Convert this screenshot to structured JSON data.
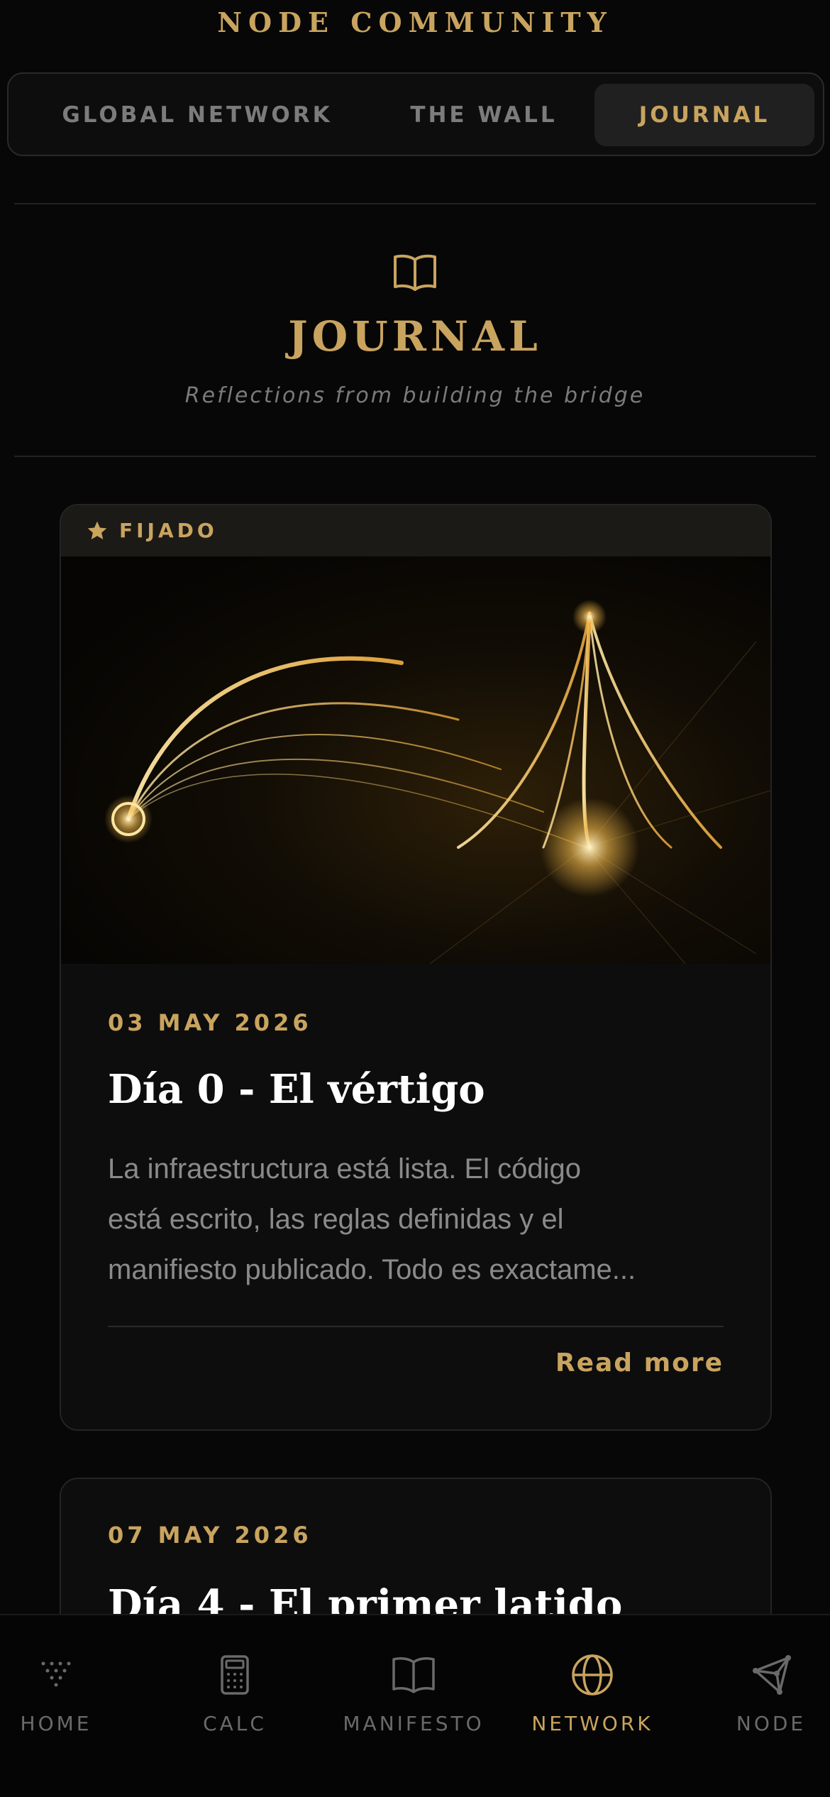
{
  "app": {
    "title": "NODE COMMUNITY"
  },
  "tabs": [
    {
      "label": "GLOBAL NETWORK",
      "active": false
    },
    {
      "label": "THE WALL",
      "active": false
    },
    {
      "label": "JOURNAL",
      "active": true
    }
  ],
  "section": {
    "icon": "book-open-icon",
    "title": "JOURNAL",
    "subtitle": "Reflections from building the bridge"
  },
  "posts": [
    {
      "pinned": true,
      "pinned_label": "FIJADO",
      "image": "golden-bridge-light-image",
      "date": "03 MAY 2026",
      "title": "Día 0 - El vértigo",
      "excerpt_lines": [
        "La infraestructura está lista. El código",
        "está escrito, las reglas definidas y el",
        "manifiesto publicado. Todo es exactame..."
      ],
      "read_more": "Read more"
    },
    {
      "pinned": false,
      "date": "07 MAY 2026",
      "title": "Día 4 - El primer latido"
    }
  ],
  "bottom_nav": [
    {
      "label": "HOME",
      "icon": "dots-triangle-icon",
      "active": false
    },
    {
      "label": "CALC",
      "icon": "calculator-icon",
      "active": false
    },
    {
      "label": "MANIFESTO",
      "icon": "book-icon",
      "active": false
    },
    {
      "label": "NETWORK",
      "icon": "globe-icon",
      "active": true
    },
    {
      "label": "NODE",
      "icon": "node-graph-icon",
      "active": false
    }
  ],
  "colors": {
    "accent": "#c9a45f",
    "background": "#070707",
    "card": "#0d0d0d",
    "muted": "#7a7a7a"
  }
}
